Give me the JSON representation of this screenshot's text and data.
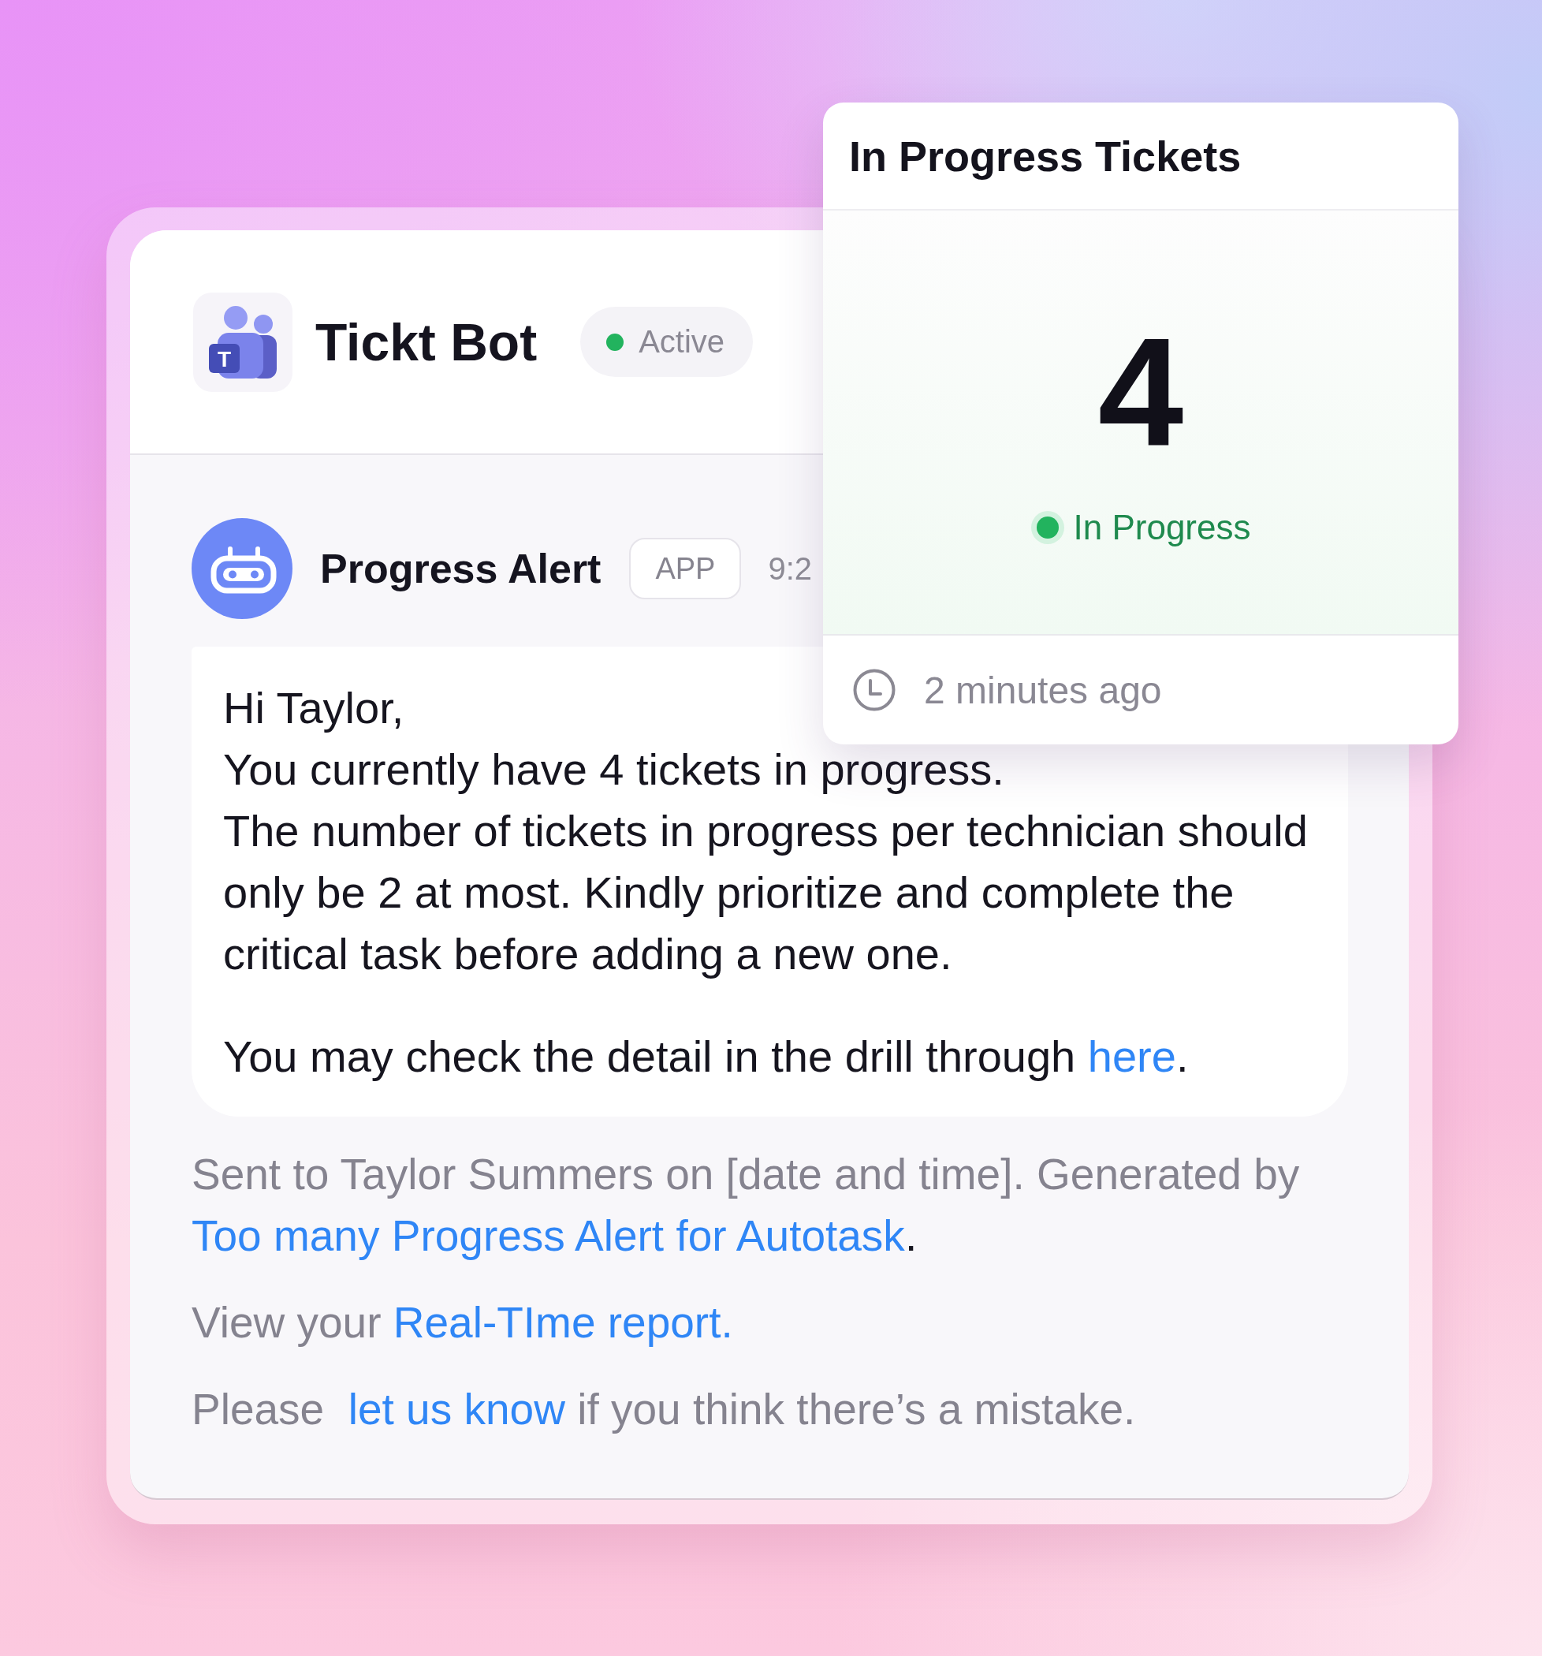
{
  "header": {
    "app_icon": {
      "letter": "T"
    },
    "title": "Tickt Bot",
    "status": "Active"
  },
  "message": {
    "sender": "Progress Alert",
    "badge": "APP",
    "time": "9:2",
    "lines": [
      "Hi Taylor,",
      "You currently have 4 tickets in progress.",
      "The number of tickets in progress per technician should only be 2 at most. Kindly prioritize and complete the critical task before adding a new one."
    ],
    "closing": {
      "runs": [
        {
          "kind": "plain",
          "text": "You may check the detail in the drill through "
        },
        {
          "kind": "link",
          "text": "here"
        },
        {
          "kind": "ink",
          "text": "."
        }
      ]
    },
    "notes": [
      {
        "runs": [
          {
            "kind": "plain",
            "text": "Sent to Taylor Summers on [date and time]. Generated by "
          },
          {
            "kind": "link",
            "text": "Too many Progress Alert for Autotask"
          },
          {
            "kind": "ink",
            "text": "."
          }
        ]
      },
      {
        "runs": [
          {
            "kind": "plain",
            "text": "View your "
          },
          {
            "kind": "link",
            "text": "Real-TIme report."
          }
        ]
      },
      {
        "runs": [
          {
            "kind": "plain",
            "text": "Please  "
          },
          {
            "kind": "link",
            "text": "let us know"
          },
          {
            "kind": "plain",
            "text": " if you think there’s a mistake."
          }
        ]
      }
    ]
  },
  "ticket_card": {
    "title": "In Progress Tickets",
    "count": "4",
    "status": "In Progress",
    "updated": "2 minutes ago"
  }
}
